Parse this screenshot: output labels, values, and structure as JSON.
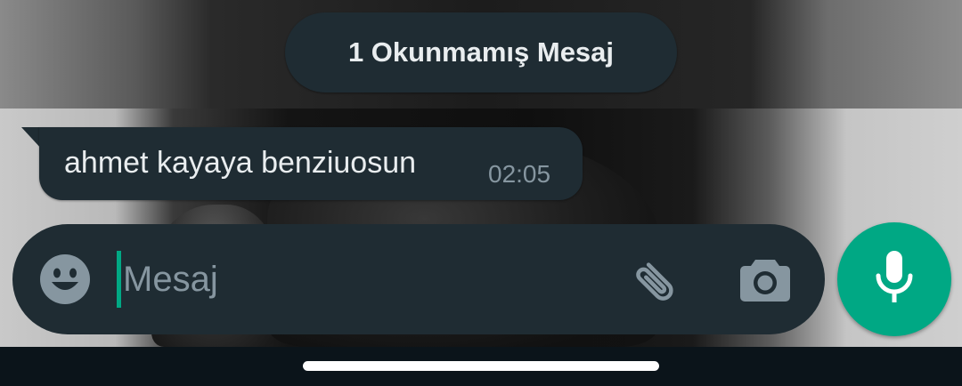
{
  "chat": {
    "unread_banner": "1 Okunmamış Mesaj",
    "messages": [
      {
        "text": "ahmet kayaya benziuosun",
        "time": "02:05",
        "direction": "incoming"
      }
    ]
  },
  "composer": {
    "placeholder": "Mesaj",
    "value": "",
    "icons": {
      "emoji": "emoji-icon",
      "attach": "paperclip-icon",
      "camera": "camera-icon",
      "send": "microphone-icon"
    }
  },
  "colors": {
    "accent": "#00a884",
    "bubble": "#1f2c33",
    "text_primary": "#e9edef",
    "text_secondary": "#8696a0"
  }
}
